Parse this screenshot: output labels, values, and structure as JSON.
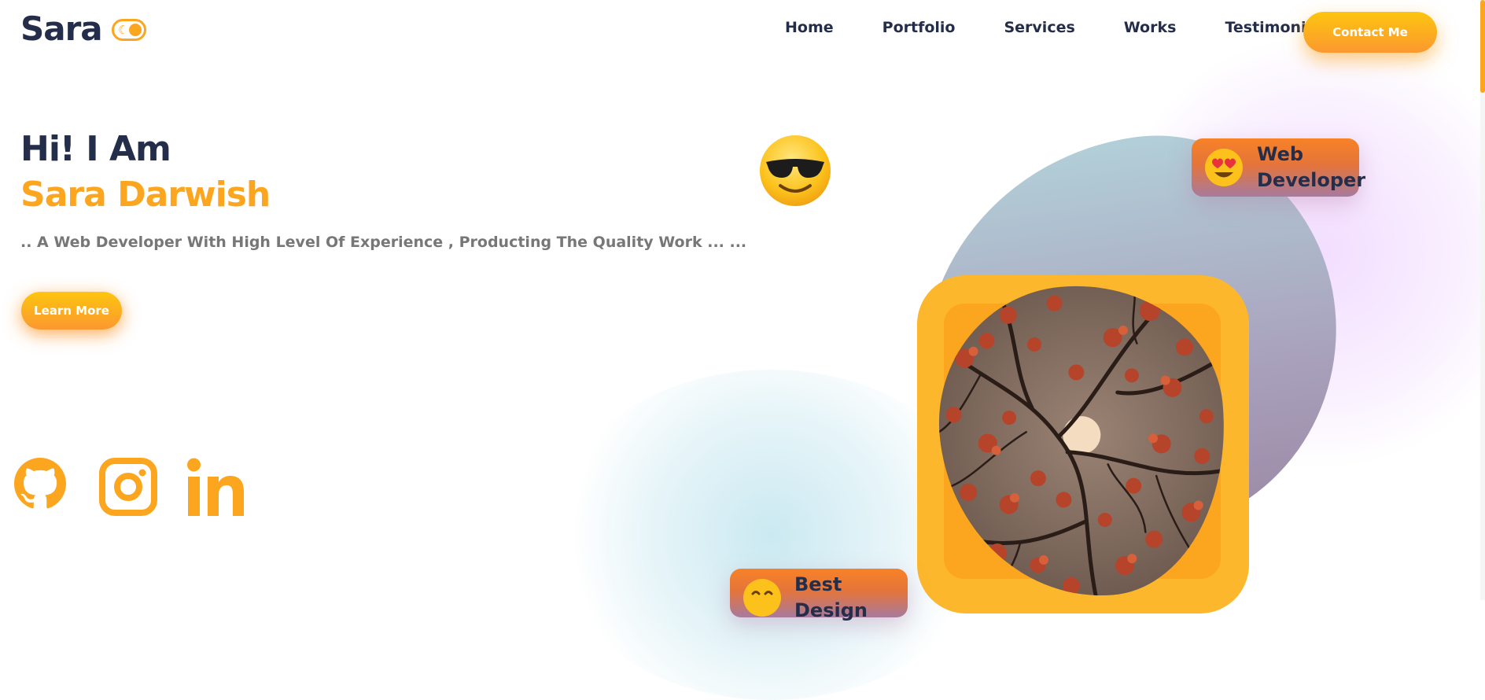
{
  "header": {
    "logo": "Sara",
    "nav": [
      "Home",
      "Portfolio",
      "Services",
      "Works",
      "Testimonials"
    ],
    "contact_label": "Contact Me"
  },
  "hero": {
    "greeting": "Hi! I Am",
    "name": "Sara Darwish",
    "description": ".. A Web Developer With High Level Of Experience , Producting The Quality Work ... ...",
    "learn_more_label": "Learn More"
  },
  "badges": {
    "web_line1": "Web",
    "web_line2": "Developer",
    "design": "Best Design"
  },
  "social_icons": [
    "github-icon",
    "instagram-icon",
    "linkedin-icon"
  ],
  "colors": {
    "accent": "#fca61f",
    "dark_text": "#242d49",
    "muted_text": "#777777"
  }
}
